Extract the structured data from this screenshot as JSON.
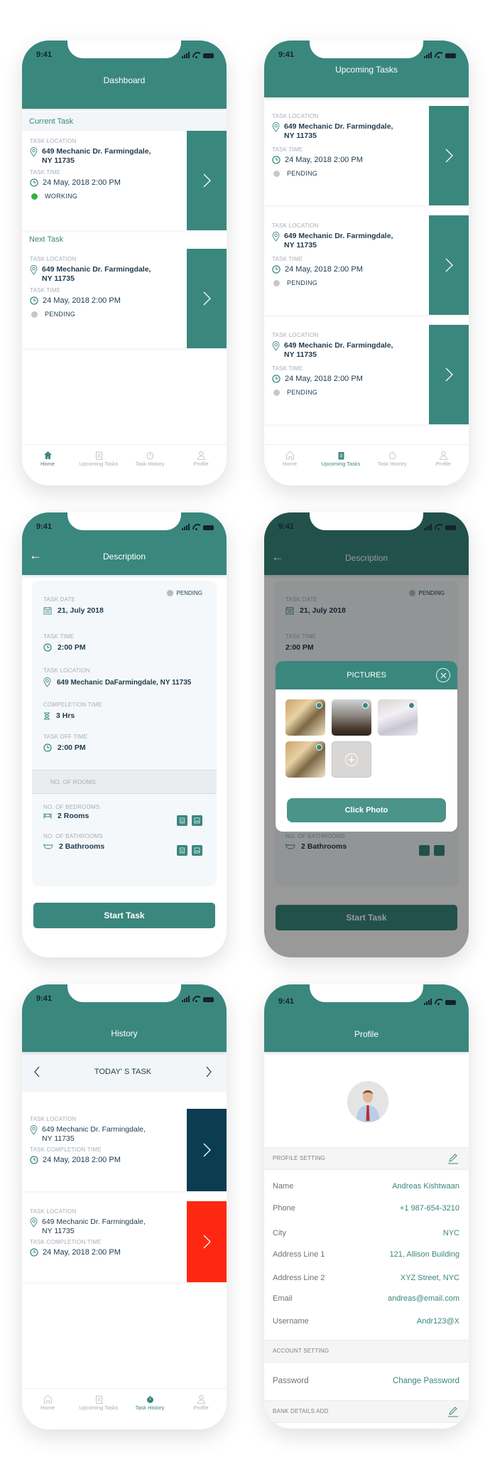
{
  "status_bar": {
    "time": "9:41"
  },
  "colors": {
    "brand": "#3a877e",
    "working": "#2fb34a",
    "pending": "#c7c7c7",
    "history_dark": "#0c3c50",
    "history_red": "#fe2712"
  },
  "bottom_nav": {
    "items": [
      {
        "label": "Home",
        "icon": "home-icon"
      },
      {
        "label": "Upcoming Tasks",
        "icon": "clipboard-icon"
      },
      {
        "label": "Task History",
        "icon": "stopwatch-icon"
      },
      {
        "label": "Profile",
        "icon": "user-icon"
      }
    ]
  },
  "dashboard": {
    "title": "Dashboard",
    "current_label": "Current Task",
    "next_label": "Next Task",
    "current_task": {
      "location_label": "TASK LOCATION",
      "address_line1": "649 Mechanic Dr. Farmingdale,",
      "address_line2": "NY 11735",
      "time_label": "TASK TIME",
      "time": "24 May, 2018  2:00 PM",
      "status": "WORKING"
    },
    "next_task": {
      "location_label": "TASK LOCATION",
      "address_line1": "649 Mechanic Dr. Farmingdale,",
      "address_line2": "NY 11735",
      "time_label": "TASK TIME",
      "time": "24 May, 2018  2:00 PM",
      "status": "PENDING"
    }
  },
  "upcoming": {
    "title": "Upcoming Tasks",
    "tasks": [
      {
        "location_label": "TASK LOCATION",
        "address_line1": "649 Mechanic Dr. Farmingdale,",
        "address_line2": "NY 11735",
        "time_label": "TASK TIME",
        "time": "24 May, 2018  2:00 PM",
        "status": "PENDING"
      },
      {
        "location_label": "TASK LOCATION",
        "address_line1": "649 Mechanic Dr. Farmingdale,",
        "address_line2": "NY 11735",
        "time_label": "TASK TIME",
        "time": "24 May, 2018  2:00 PM",
        "status": "PENDING"
      },
      {
        "location_label": "TASK LOCATION",
        "address_line1": "649 Mechanic Dr. Farmingdale,",
        "address_line2": "NY 11735",
        "time_label": "TASK TIME",
        "time": "24 May, 2018  2:00 PM",
        "status": "PENDING"
      }
    ]
  },
  "description": {
    "title": "Description",
    "status": "PENDING",
    "task_date_label": "TASK DATE",
    "task_date": "21, July  2018",
    "task_time_label": "TASK TIME",
    "task_time": "2:00 PM",
    "task_location_label": "TASK LOCATION",
    "task_location": "649 Mechanic  DaFarmingdale, NY 11735",
    "completion_label": "COMPELETION TIME",
    "completion": "3 Hrs",
    "off_time_label": "TASK OFF TIME",
    "off_time": "2:00 PM",
    "rooms_header": "NO. OF ROOMS",
    "bedrooms_label": "NO. OF BEDROOMS",
    "bedrooms": "2 Rooms",
    "bathrooms_label": "NO. OF BATHROOMS",
    "bathrooms": "2 Bathrooms",
    "start_button": "Start Task"
  },
  "pictures_modal": {
    "title": "PICTURES",
    "photos": [
      "bedroom-photo",
      "living-room-photo",
      "bed-sheets-photo",
      "bedroom-photo"
    ],
    "button": "Click Photo"
  },
  "history": {
    "title": "History",
    "day_title": "TODAY' S TASK",
    "tasks": [
      {
        "location_label": "TASK LOCATION",
        "address_line1": "649 Mechanic Dr. Farmingdale,",
        "address_line2": "NY 11735",
        "time_label": "TASK COMPLETION TIME",
        "time": "24 May, 2018  2:00 PM"
      },
      {
        "location_label": "TASK LOCATION",
        "address_line1": "649 Mechanic Dr. Farmingdale,",
        "address_line2": "NY 11735",
        "time_label": "TASK COMPLETION TIME",
        "time": "24 May, 2018  2:00 PM"
      }
    ]
  },
  "profile": {
    "title": "Profile",
    "profile_setting_label": "PROFILE SETTING",
    "fields": [
      {
        "key": "Name",
        "value": "Andreas Kishtwaan"
      },
      {
        "key": "Phone",
        "value": "+1 987-654-3210"
      },
      {
        "key": "City",
        "value": "NYC"
      },
      {
        "key": "Address Line 1",
        "value": "121, Allison Building"
      },
      {
        "key": "Address Line 2",
        "value": "XYZ Street, NYC"
      },
      {
        "key": "Email",
        "value": "andreas@email.com"
      },
      {
        "key": "Username",
        "value": "Andr123@X"
      }
    ],
    "account_setting_label": "ACCOUNT SETTING",
    "password_label": "Password",
    "password_action": "Change Password",
    "bank_label": "BANK DETAILS ADD"
  }
}
